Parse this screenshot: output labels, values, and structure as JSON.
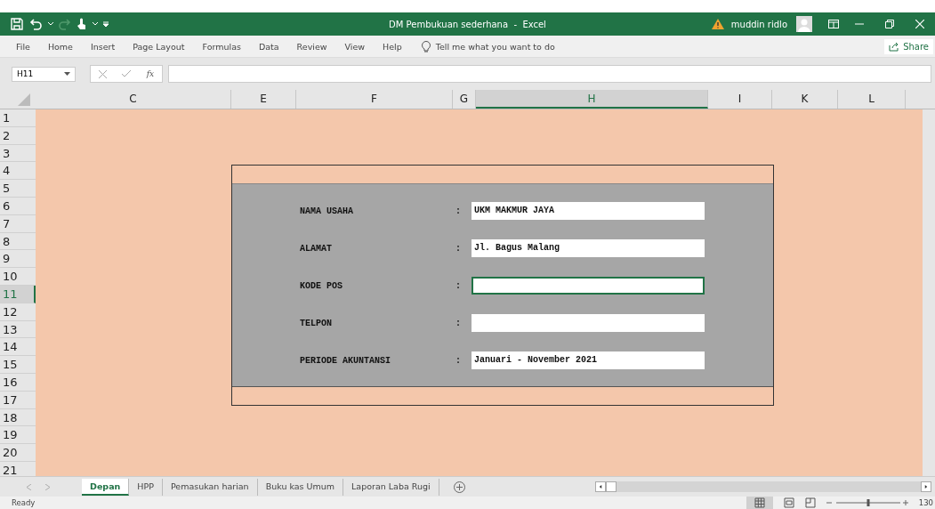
{
  "window": {
    "title": "DM Pembukuan sederhana  -  Excel",
    "user": "muddin ridlo"
  },
  "ribbon_tabs": [
    "File",
    "Home",
    "Insert",
    "Page Layout",
    "Formulas",
    "Data",
    "Review",
    "View",
    "Help"
  ],
  "tell_me": {
    "placeholder": "Tell me what you want to do"
  },
  "share": "Share",
  "formula_bar": {
    "name_box": "H11",
    "fx": "fx"
  },
  "columns": [
    {
      "label": "C",
      "selected": false
    },
    {
      "label": "E",
      "selected": false
    },
    {
      "label": "F",
      "selected": false
    },
    {
      "label": "G",
      "selected": false
    },
    {
      "label": "H",
      "selected": true
    },
    {
      "label": "I",
      "selected": false
    },
    {
      "label": "K",
      "selected": false
    },
    {
      "label": "L",
      "selected": false
    }
  ],
  "rows": [
    {
      "label": "1",
      "selected": false
    },
    {
      "label": "2",
      "selected": false
    },
    {
      "label": "3",
      "selected": false
    },
    {
      "label": "4",
      "selected": false
    },
    {
      "label": "5",
      "selected": false
    },
    {
      "label": "6",
      "selected": false
    },
    {
      "label": "7",
      "selected": false
    },
    {
      "label": "8",
      "selected": false
    },
    {
      "label": "9",
      "selected": false
    },
    {
      "label": "10",
      "selected": false
    },
    {
      "label": "11",
      "selected": true
    },
    {
      "label": "12",
      "selected": false
    },
    {
      "label": "13",
      "selected": false
    },
    {
      "label": "14",
      "selected": false
    },
    {
      "label": "15",
      "selected": false
    },
    {
      "label": "16",
      "selected": false
    },
    {
      "label": "17",
      "selected": false
    },
    {
      "label": "18",
      "selected": false
    },
    {
      "label": "19",
      "selected": false
    },
    {
      "label": "20",
      "selected": false
    },
    {
      "label": "21",
      "selected": false
    }
  ],
  "form": [
    {
      "label": "NAMA USAHA",
      "colon": ":",
      "value": "UKM MAKMUR JAYA",
      "selected": false
    },
    {
      "label": "ALAMAT",
      "colon": ":",
      "value": "Jl. Bagus Malang",
      "selected": false
    },
    {
      "label": "KODE POS",
      "colon": ":",
      "selected": true
    },
    {
      "label": "TELPON",
      "colon": ":",
      "selected": false
    },
    {
      "label": "PERIODE AKUNTANSI",
      "colon": ":",
      "value": "Januari - November 2021",
      "selected": false
    }
  ],
  "sheet_tabs": [
    {
      "label": "Depan",
      "selected": true
    },
    {
      "label": "HPP",
      "selected": false
    },
    {
      "label": "Pemasukan harian",
      "selected": false
    },
    {
      "label": "Buku kas Umum",
      "selected": false
    },
    {
      "label": "Laporan Laba Rugi",
      "selected": false
    }
  ],
  "status_bar": {
    "status": "Ready",
    "zoom": "130",
    "zoom_slider": {
      "level": 0.5
    }
  }
}
